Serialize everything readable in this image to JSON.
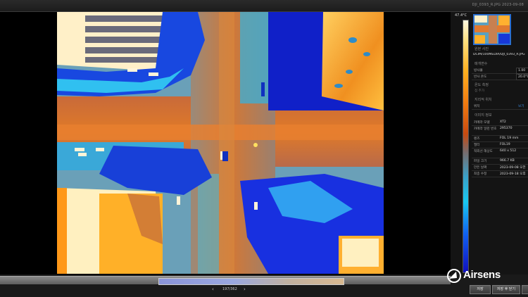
{
  "window": {
    "title": "DJI_0393_R.JPG     2023-09-08"
  },
  "colorbar": {
    "max_label": "47.4°C",
    "gradient": [
      "#fff8e0",
      "#ffb020",
      "#c84a10",
      "#18c8f0",
      "#1060f0",
      "#1010c0"
    ]
  },
  "thumbnail": {
    "filename": "DJI_0393_R.JPG"
  },
  "panel": {
    "file_section": "원본 사진",
    "file_path": "DCIM/100MEDIA/DJI_0393_R.JPG",
    "params_section": "매개변수",
    "params": [
      {
        "label": "방사율",
        "value": "1.00"
      },
      {
        "label": "반사 온도",
        "value": "20.0°C"
      }
    ],
    "point_section": "온도 측정",
    "point_hint": "점 추가",
    "location_section": "지리적 위치",
    "location_label": "위치",
    "location_link": "보기",
    "image_section": "이미지 정보",
    "image_info": [
      {
        "label": "카메라 모델",
        "value": "XT2"
      },
      {
        "label": "카메라 일련 번호",
        "value": "295370"
      },
      {
        "label": "렌즈",
        "value": "FOL 19 mm"
      },
      {
        "label": "필터",
        "value": "FOL19"
      },
      {
        "label": "적외선 해상도",
        "value": "640 x 512"
      },
      {
        "label": "파일 크기",
        "value": "966.7 KB"
      },
      {
        "label": "만든 날짜",
        "value": "2023-09-08 오전"
      },
      {
        "label": "최종 수정",
        "value": "2023-09-18 오후"
      }
    ]
  },
  "navigation": {
    "counter": "197/362",
    "prev": "‹",
    "next": "›"
  },
  "brand": {
    "name": "Airsens"
  },
  "buttons": {
    "save": "저장",
    "save_close": "저장 후 닫기"
  }
}
